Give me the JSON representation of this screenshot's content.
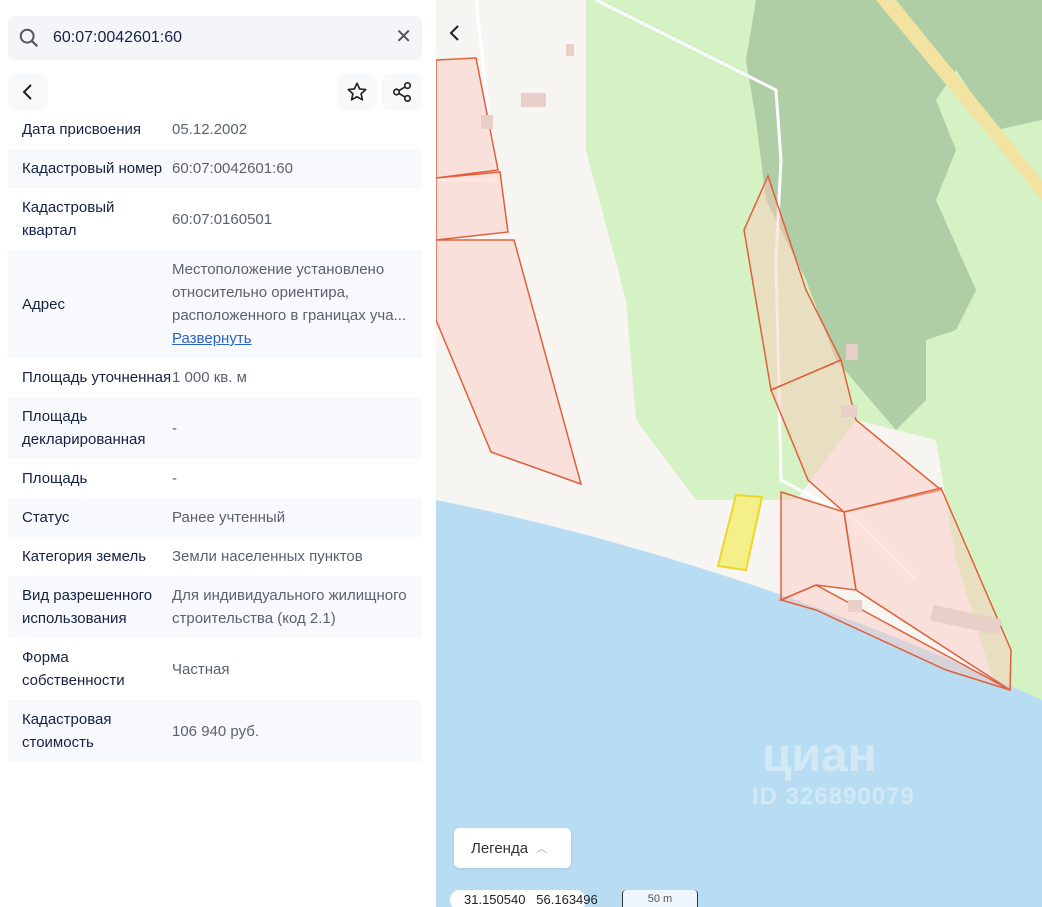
{
  "search": {
    "value": "60:07:0042601:60"
  },
  "rows": [
    {
      "label": "Дата присвоения",
      "value": "05.12.2002"
    },
    {
      "label": "Кадастровый номер",
      "value": "60:07:0042601:60"
    },
    {
      "label": "Кадастровый квартал",
      "value": "60:07:0160501"
    },
    {
      "label": "Адрес",
      "value": "Местоположение установлено относительно ориентира, расположенного в границах уча...",
      "link": "Развернуть"
    },
    {
      "label": "Площадь уточненная",
      "value": "1 000 кв. м"
    },
    {
      "label": "Площадь декларированная",
      "value": "-"
    },
    {
      "label": "Площадь",
      "value": "-"
    },
    {
      "label": "Статус",
      "value": "Ранее учтенный"
    },
    {
      "label": "Категория земель",
      "value": "Земли населенных пунктов"
    },
    {
      "label": "Вид разрешенного использования",
      "value": "Для индивидуального жилищного строительства (код 2.1)"
    },
    {
      "label": "Форма собственности",
      "value": "Частная"
    },
    {
      "label": "Кадастровая стоимость",
      "value": "106 940 руб."
    }
  ],
  "map": {
    "legend": "Легенда",
    "coords": "31.150540   56.163496",
    "scale": "50 m",
    "watermark": "циан",
    "watermark_id": "ID 326890079"
  }
}
